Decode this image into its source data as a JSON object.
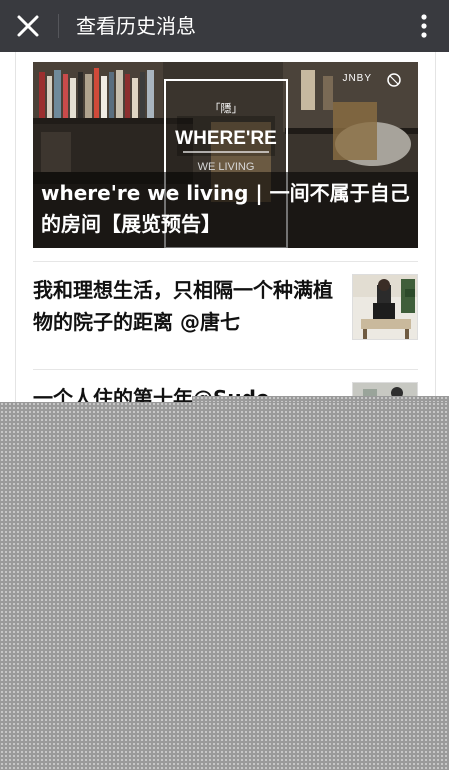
{
  "topbar": {
    "title": "查看历史消息",
    "close_icon": "close-icon",
    "more_icon": "more-vertical-icon"
  },
  "hero": {
    "caption": "where're we living | 一间不属于自己的房间【展览预告】",
    "poster_mark": "「隱」",
    "poster_title": "WHERE'RE",
    "poster_sub": "WE LIVING",
    "brand": "JNBY"
  },
  "articles": [
    {
      "title": "我和理想生活，只相隔一个种满植物的院子的距离 @唐七"
    },
    {
      "title": "一个人住的第十年@Sude"
    }
  ],
  "colors": {
    "topbar_bg": "#393a3f",
    "mask": "#9a9a9a"
  }
}
